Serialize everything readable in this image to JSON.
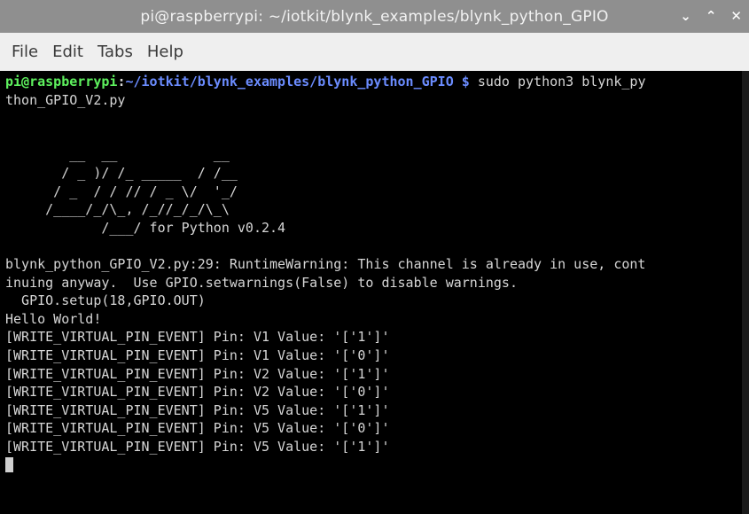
{
  "window": {
    "title": "pi@raspberrypi: ~/iotkit/blynk_examples/blynk_python_GPIO",
    "controls": [
      "⌄",
      "⌃",
      "✕"
    ]
  },
  "menu": {
    "items": [
      "File",
      "Edit",
      "Tabs",
      "Help"
    ]
  },
  "terminal": {
    "prompt": {
      "user": "pi@raspberrypi",
      "sep": ":",
      "path": "~/iotkit/blynk_examples/blynk_python_GPIO",
      "dollar": " $",
      "command": " sudo python3 blynk_py"
    },
    "command_wrap": "thon_GPIO_V2.py",
    "blank_1": "",
    "blank_2": "",
    "logo": [
      "        __  __            __",
      "       / _ )/ /_ _____  / /__",
      "      / _  / / // / _ \\/  '_/",
      "     /____/_/\\_, /_//_/_/\\_\\",
      "            /___/ for Python v0.2.4"
    ],
    "blank_3": "",
    "warning_1": "blynk_python_GPIO_V2.py:29: RuntimeWarning: This channel is already in use, cont",
    "warning_2": "inuing anyway.  Use GPIO.setwarnings(False) to disable warnings.",
    "warning_3": "  GPIO.setup(18,GPIO.OUT)",
    "hello": "Hello World!",
    "events": [
      "[WRITE_VIRTUAL_PIN_EVENT] Pin: V1 Value: '['1']'",
      "[WRITE_VIRTUAL_PIN_EVENT] Pin: V1 Value: '['0']'",
      "[WRITE_VIRTUAL_PIN_EVENT] Pin: V2 Value: '['1']'",
      "[WRITE_VIRTUAL_PIN_EVENT] Pin: V2 Value: '['0']'",
      "[WRITE_VIRTUAL_PIN_EVENT] Pin: V5 Value: '['1']'",
      "[WRITE_VIRTUAL_PIN_EVENT] Pin: V5 Value: '['0']'",
      "[WRITE_VIRTUAL_PIN_EVENT] Pin: V5 Value: '['1']'"
    ]
  },
  "colors": {
    "titlebar_bg": "#8f8f8f",
    "menubar_bg": "#efefef",
    "terminal_bg": "#000000",
    "terminal_fg": "#d6d6d6",
    "prompt_user": "#5ef15e",
    "prompt_path": "#6b8cff"
  }
}
